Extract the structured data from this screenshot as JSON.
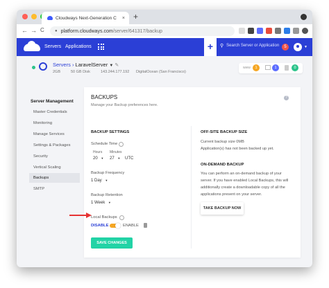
{
  "browser": {
    "tab_title": "Cloudways Next-Generation C",
    "tab_close": "×",
    "new_tab": "+",
    "url_host": "platform.cloudways.com",
    "url_path": "/server/641317/backup",
    "back": "←",
    "forward": "→",
    "reload": "C",
    "lock_icon": "lock-icon"
  },
  "header": {
    "nav": [
      "Servers",
      "Applications"
    ],
    "plus": "+",
    "search_placeholder": "Search Server or Application",
    "notification_count": "5"
  },
  "server": {
    "crumb": "Servers",
    "separator": "›",
    "name": "LaravelServer",
    "ram": "2GB",
    "disk": "50 GB Disk",
    "ip": "143.244.177.192",
    "location": "DigitalOcean (San Francisco)",
    "status": [
      {
        "label": "www",
        "count": "1",
        "color": "#f5a623"
      },
      {
        "label": "",
        "count": "1",
        "color": "#5b6cff"
      },
      {
        "label": "",
        "count": "0",
        "color": "#2bc38a"
      }
    ]
  },
  "sidebar": {
    "title": "Server Management",
    "items": [
      "Master Credentials",
      "Monitoring",
      "Manage Services",
      "Settings & Packages",
      "Security",
      "Vertical Scaling",
      "Backups",
      "SMTP"
    ],
    "active_index": 6
  },
  "backups": {
    "title": "BACKUPS",
    "subtitle": "Manage your Backup preferences here.",
    "help": "?",
    "settings_title": "BACKUP SETTINGS",
    "schedule_label": "Schedule Time",
    "hours_label": "Hours",
    "minutes_label": "Minutes",
    "hours_value": "20",
    "minutes_value": "27",
    "timezone": "UTC",
    "frequency_label": "Backup Frequency",
    "frequency_value": "1 Day",
    "retention_label": "Backup Retention",
    "retention_value": "1 Week",
    "local_label": "Local Backups",
    "disable_label": "DISABLE",
    "enable_label": "ENABLE",
    "save_button": "SAVE CHANGES"
  },
  "offsite": {
    "title": "OFF-SITE BACKUP SIZE",
    "size_line": "Current backup size 0MB",
    "status_line": "Application(s) has not been backed up yet.",
    "ondemand_title": "ON-DEMAND BACKUP",
    "desc_lines": [
      "You can perform an on-demand backup of your",
      "server. If you have enabled Local Backups, this will",
      "additionally create a downloadable copy of all the",
      "applications present on your server."
    ],
    "button": "TAKE BACKUP NOW"
  },
  "colors": {
    "accent": "#2b3fd6",
    "save": "#22d3a6",
    "toggle": "#f5a623",
    "arrow": "#e63333"
  }
}
